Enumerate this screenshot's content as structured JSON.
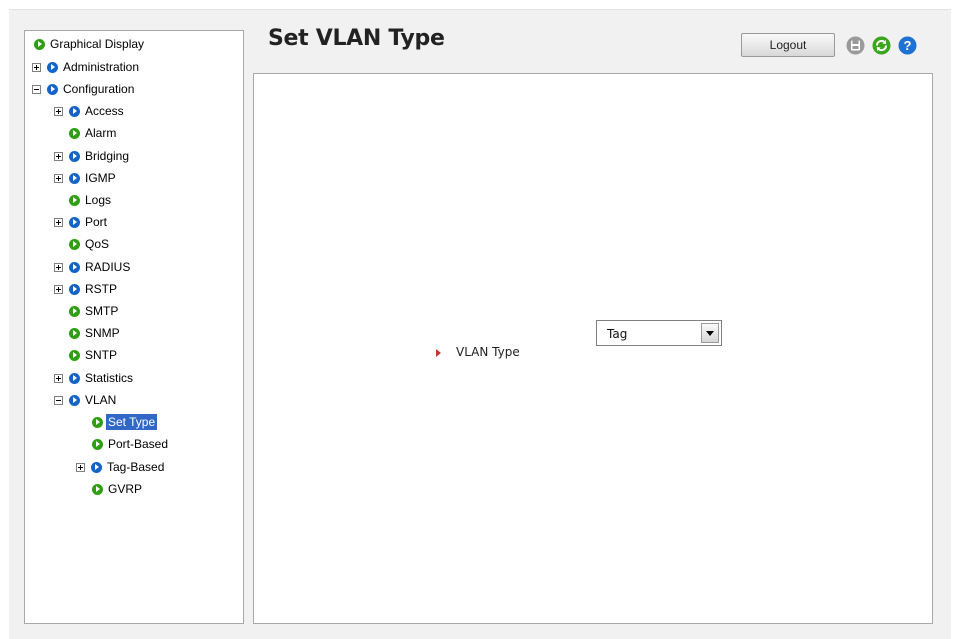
{
  "header": {
    "title": "Set VLAN Type",
    "logout_label": "Logout",
    "icons": [
      "save-icon",
      "refresh-icon",
      "help-icon"
    ]
  },
  "colors": {
    "leaf_bullet": "#2e9e12",
    "branch_bullet": "#1464c8",
    "selection": "#3168c8",
    "field_arrow": "#c0392b"
  },
  "tree": {
    "items": [
      {
        "label": "Graphical Display",
        "expander": "none",
        "bullet": "leaf"
      },
      {
        "label": "Administration",
        "expander": "plus",
        "bullet": "branch"
      },
      {
        "label": "Configuration",
        "expander": "minus",
        "bullet": "branch"
      },
      {
        "label": "Access",
        "expander": "plus",
        "bullet": "branch"
      },
      {
        "label": "Alarm",
        "expander": "none",
        "bullet": "leaf"
      },
      {
        "label": "Bridging",
        "expander": "plus",
        "bullet": "branch"
      },
      {
        "label": "IGMP",
        "expander": "plus",
        "bullet": "branch"
      },
      {
        "label": "Logs",
        "expander": "none",
        "bullet": "leaf"
      },
      {
        "label": "Port",
        "expander": "plus",
        "bullet": "branch"
      },
      {
        "label": "QoS",
        "expander": "none",
        "bullet": "leaf"
      },
      {
        "label": "RADIUS",
        "expander": "plus",
        "bullet": "branch"
      },
      {
        "label": "RSTP",
        "expander": "plus",
        "bullet": "branch"
      },
      {
        "label": "SMTP",
        "expander": "none",
        "bullet": "leaf"
      },
      {
        "label": "SNMP",
        "expander": "none",
        "bullet": "leaf"
      },
      {
        "label": "SNTP",
        "expander": "none",
        "bullet": "leaf"
      },
      {
        "label": "Statistics",
        "expander": "plus",
        "bullet": "branch"
      },
      {
        "label": "VLAN",
        "expander": "minus",
        "bullet": "branch"
      },
      {
        "label": "Set Type",
        "expander": "none",
        "bullet": "leaf",
        "selected": true
      },
      {
        "label": "Port-Based",
        "expander": "none",
        "bullet": "leaf"
      },
      {
        "label": "Tag-Based",
        "expander": "plus",
        "bullet": "branch"
      },
      {
        "label": "GVRP",
        "expander": "none",
        "bullet": "leaf"
      }
    ]
  },
  "form": {
    "vlan_type_label": "VLAN Type",
    "vlan_type_value": "Tag"
  }
}
